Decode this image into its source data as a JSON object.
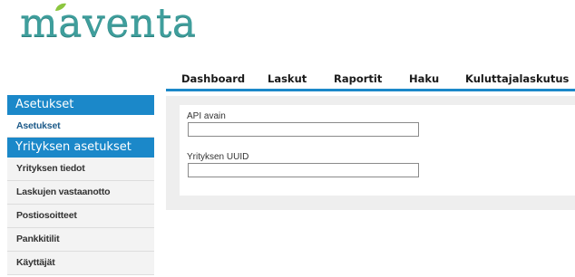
{
  "brand": {
    "logo_text": "maventa",
    "logo_color": "#3f9e9c",
    "leaf_color": "#8cc63f"
  },
  "colors": {
    "accent": "#1b88c9",
    "panel_bg": "#eeeeee"
  },
  "topnav": {
    "tabs": [
      {
        "label": "Dashboard"
      },
      {
        "label": "Laskut"
      },
      {
        "label": "Raportit"
      },
      {
        "label": "Haku"
      },
      {
        "label": "Kuluttajalaskutus"
      }
    ]
  },
  "sidebar": {
    "section1": {
      "header": "Asetukset",
      "items": [
        {
          "label": "Asetukset",
          "active": true
        }
      ]
    },
    "section2": {
      "header": "Yrityksen asetukset",
      "items": [
        {
          "label": "Yrityksen tiedot"
        },
        {
          "label": "Laskujen vastaanotto"
        },
        {
          "label": "Postiosoitteet"
        },
        {
          "label": "Pankkitilit"
        },
        {
          "label": "Käyttäjät"
        }
      ]
    }
  },
  "form": {
    "api_key": {
      "label": "API avain",
      "value": ""
    },
    "company_uuid": {
      "label": "Yrityksen UUID",
      "value": ""
    }
  }
}
